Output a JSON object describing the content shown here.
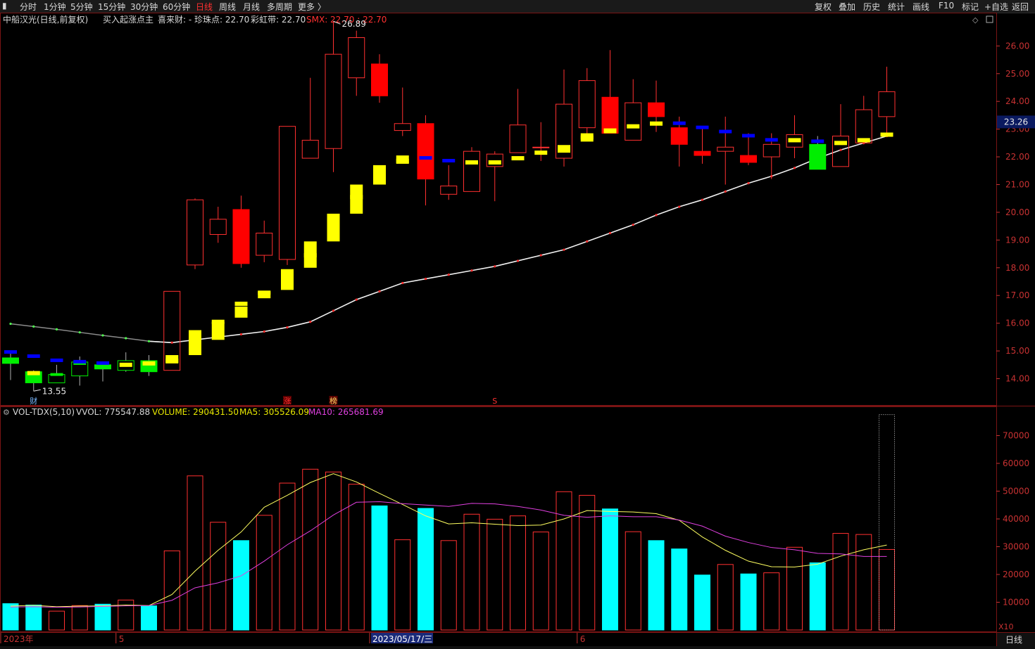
{
  "toolbar": {
    "left_icon": "menu-icon",
    "periods": [
      "分时",
      "1分钟",
      "5分钟",
      "15分钟",
      "30分钟",
      "60分钟",
      "日线",
      "周线",
      "月线",
      "多周期",
      "更多 〉"
    ],
    "active_period": "日线",
    "right": [
      "复权",
      "叠加",
      "历史",
      "统计",
      "画线",
      "F10",
      "标记",
      "+自选",
      "返回"
    ]
  },
  "price_header": {
    "title": "中船汉光(日线,前复权)",
    "indicator": "买入起涨点主",
    "field1": "喜来财: -",
    "field2": "珍珠点: 22.70",
    "field3": "彩虹带: 22.70",
    "field4": "SMX: 22.70 : 22.70"
  },
  "volume_header": {
    "name": "VOL-TDX(5,10)",
    "vvol": "VVOL: 775547.88",
    "volume": "VOLUME: 290431.50",
    "ma5": "MA5: 305526.09",
    "ma10": "MA10: 265681.69"
  },
  "current_price_label": "23.26",
  "volume_unit": "X10",
  "period_label": "日线",
  "colors": {
    "up": "#ff3030",
    "down": "#00ffff",
    "red_fill": "#ff0000",
    "green_fill": "#00ee00",
    "yellow": "#ffff00",
    "blue": "#0000ff",
    "ma5": "#ffff60",
    "ma10": "#e040e0",
    "axis_text": "#c83232"
  },
  "chart_data": [
    {
      "type": "candlestick",
      "title": "中船汉光(日线,前复权)",
      "y_ticks": [
        14.0,
        15.0,
        16.0,
        17.0,
        18.0,
        19.0,
        20.0,
        21.0,
        22.0,
        23.0,
        24.0,
        25.0,
        26.0
      ],
      "ylim": [
        13.05,
        27.2
      ],
      "annotations": [
        {
          "text": "26.89",
          "value": 26.89,
          "bar": 14
        },
        {
          "text": "13.55",
          "value": 13.55,
          "bar": 1
        }
      ],
      "signals": [
        {
          "bar": 1,
          "text": "财"
        },
        {
          "bar": 12,
          "text": "涨"
        },
        {
          "bar": 14,
          "text": "榜"
        },
        {
          "bar": 21,
          "text": "S"
        }
      ],
      "x_date_labels": [
        {
          "bar": 0,
          "text": "2023年"
        },
        {
          "bar": 5,
          "text": "5"
        },
        {
          "bar": 16,
          "text": "2023/05/17/三"
        },
        {
          "bar": 25,
          "text": "6"
        }
      ],
      "bars": [
        {
          "o": 14.75,
          "h": 14.9,
          "l": 13.95,
          "c": 14.55,
          "style": "green",
          "dot": 14.65,
          "dotc": "green",
          "blue": 14.95
        },
        {
          "o": 14.25,
          "h": 14.3,
          "l": 13.55,
          "c": 13.85,
          "style": "green",
          "dot": 14.2,
          "dotc": "yellow",
          "blue": 14.8
        },
        {
          "o": 13.85,
          "h": 14.5,
          "l": 13.85,
          "c": 14.15,
          "style": "outline_green",
          "dot": 14.15,
          "dotc": "green",
          "blue": 14.65
        },
        {
          "o": 14.1,
          "h": 14.8,
          "l": 13.75,
          "c": 14.6,
          "style": "outline_green",
          "dot": 14.55,
          "dotc": "green",
          "blue": 14.6
        },
        {
          "o": 14.5,
          "h": 14.6,
          "l": 13.9,
          "c": 14.35,
          "style": "green",
          "dot": 14.45,
          "dotc": "green",
          "blue": 14.55
        },
        {
          "o": 14.3,
          "h": 14.95,
          "l": 14.25,
          "c": 14.65,
          "style": "outline_green",
          "dot": 14.5,
          "dotc": "yellow",
          "blue": null
        },
        {
          "o": 14.65,
          "h": 14.85,
          "l": 14.1,
          "c": 14.25,
          "style": "green",
          "dot": 14.55,
          "dotc": "yellow",
          "blue": null
        },
        {
          "o": 14.3,
          "h": 17.15,
          "l": 14.3,
          "c": 17.15,
          "style": "outline_red",
          "dot": 14.65,
          "dotc": "yellow",
          "blue": null
        },
        {
          "o": 18.1,
          "h": 20.5,
          "l": 17.95,
          "c": 20.45,
          "style": "outline_red",
          "dot": 15.25,
          "dotc": "yellow",
          "blue": null
        },
        {
          "o": 19.2,
          "h": 20.2,
          "l": 18.9,
          "c": 19.75,
          "style": "outline_red",
          "dot": 16.05,
          "dotc": "yellow",
          "blue": null
        },
        {
          "o": 20.1,
          "h": 20.6,
          "l": 18.0,
          "c": 18.15,
          "style": "red",
          "dot": 16.7,
          "dotc": "yellow",
          "blue": null
        },
        {
          "o": 18.45,
          "h": 19.7,
          "l": 18.2,
          "c": 19.25,
          "style": "outline_red",
          "dot": 17.1,
          "dotc": "yellow",
          "blue": null
        },
        {
          "o": 18.3,
          "h": 23.1,
          "l": 18.1,
          "c": 23.1,
          "style": "outline_red",
          "dot": 17.5,
          "dotc": "yellow",
          "blue": null
        },
        {
          "o": 21.95,
          "h": 24.85,
          "l": 21.95,
          "c": 22.6,
          "style": "outline_red",
          "dot": 18.45,
          "dotc": "yellow",
          "blue": null
        },
        {
          "o": 22.3,
          "h": 26.89,
          "l": 21.45,
          "c": 25.7,
          "style": "outline_red",
          "dot": 19.45,
          "dotc": "yellow",
          "blue": null
        },
        {
          "o": 24.85,
          "h": 26.55,
          "l": 24.2,
          "c": 26.3,
          "style": "outline_red",
          "dot": 20.55,
          "dotc": "yellow",
          "blue": null
        },
        {
          "o": 25.35,
          "h": 25.7,
          "l": 23.95,
          "c": 24.2,
          "style": "red",
          "dot": 21.4,
          "dotc": "yellow",
          "blue": null
        },
        {
          "o": 22.95,
          "h": 24.5,
          "l": 22.75,
          "c": 23.2,
          "style": "outline_red",
          "dot": 21.85,
          "dotc": "yellow",
          "blue": null
        },
        {
          "o": 23.2,
          "h": 23.5,
          "l": 20.25,
          "c": 21.2,
          "style": "red",
          "dot": 21.95,
          "dotc": "blue",
          "blue": null
        },
        {
          "o": 20.65,
          "h": 21.7,
          "l": 20.45,
          "c": 20.95,
          "style": "outline_red",
          "dot": 21.85,
          "dotc": "blue",
          "blue": null
        },
        {
          "o": 20.75,
          "h": 22.35,
          "l": 20.75,
          "c": 22.2,
          "style": "outline_red",
          "dot": 21.8,
          "dotc": "yellow",
          "blue": null
        },
        {
          "o": 21.65,
          "h": 22.2,
          "l": 20.4,
          "c": 22.1,
          "style": "outline_red",
          "dot": 21.8,
          "dotc": "yellow",
          "blue": null
        },
        {
          "o": 22.15,
          "h": 24.45,
          "l": 22.15,
          "c": 23.15,
          "style": "outline_red",
          "dot": 21.95,
          "dotc": "yellow",
          "blue": null
        },
        {
          "o": 22.35,
          "h": 23.25,
          "l": 21.85,
          "c": 22.35,
          "style": "outline_red",
          "dot": 22.15,
          "dotc": "yellow",
          "blue": null
        },
        {
          "o": 21.95,
          "h": 25.15,
          "l": 21.65,
          "c": 23.9,
          "style": "outline_red",
          "dot": 22.35,
          "dotc": "yellow",
          "blue": null
        },
        {
          "o": 23.05,
          "h": 25.2,
          "l": 22.6,
          "c": 24.75,
          "style": "outline_red",
          "dot": 22.7,
          "dotc": "yellow",
          "blue": null
        },
        {
          "o": 24.15,
          "h": 25.85,
          "l": 22.85,
          "c": 22.85,
          "style": "red",
          "dot": 22.95,
          "dotc": "yellow",
          "blue": null
        },
        {
          "o": 22.6,
          "h": 24.8,
          "l": 22.6,
          "c": 23.95,
          "style": "outline_red",
          "dot": 23.1,
          "dotc": "yellow",
          "blue": null
        },
        {
          "o": 23.95,
          "h": 24.75,
          "l": 22.9,
          "c": 23.45,
          "style": "red",
          "dot": 23.2,
          "dotc": "yellow",
          "blue": null
        },
        {
          "o": 23.05,
          "h": 23.45,
          "l": 21.65,
          "c": 22.45,
          "style": "red",
          "dot": 23.2,
          "dotc": "blue",
          "blue": null
        },
        {
          "o": 22.05,
          "h": 23.05,
          "l": 21.75,
          "c": 22.2,
          "style": "red",
          "dot": 23.05,
          "dotc": "blue",
          "blue": null
        },
        {
          "o": 22.2,
          "h": 23.45,
          "l": 21.0,
          "c": 22.35,
          "style": "outline_red",
          "dot": 22.9,
          "dotc": "blue",
          "blue": null
        },
        {
          "o": 22.05,
          "h": 22.85,
          "l": 21.7,
          "c": 21.8,
          "style": "red",
          "dot": 22.75,
          "dotc": "blue",
          "blue": null
        },
        {
          "o": 22.0,
          "h": 22.85,
          "l": 21.2,
          "c": 22.45,
          "style": "outline_red",
          "dot": 22.6,
          "dotc": "blue",
          "blue": null
        },
        {
          "o": 22.35,
          "h": 23.5,
          "l": 21.95,
          "c": 22.8,
          "style": "outline_red",
          "dot": 22.6,
          "dotc": "yellow",
          "blue": null
        },
        {
          "o": 22.45,
          "h": 22.75,
          "l": 21.55,
          "c": 21.55,
          "style": "green",
          "dot": 22.55,
          "dotc": "blue",
          "blue": null
        },
        {
          "o": 21.65,
          "h": 23.9,
          "l": 21.65,
          "c": 22.75,
          "style": "outline_red",
          "dot": 22.5,
          "dotc": "yellow",
          "blue": null
        },
        {
          "o": 22.5,
          "h": 24.2,
          "l": 22.45,
          "c": 23.7,
          "style": "outline_red",
          "dot": 22.6,
          "dotc": "yellow",
          "blue": null
        },
        {
          "o": 23.45,
          "h": 25.25,
          "l": 22.85,
          "c": 24.35,
          "style": "outline_red",
          "dot": 22.8,
          "dotc": "yellow",
          "blue": null
        }
      ],
      "ma_line": {
        "name": "SMX",
        "points": [
          [
            0,
            15.98
          ],
          [
            1,
            15.88
          ],
          [
            2,
            15.78
          ],
          [
            3,
            15.67
          ],
          [
            4,
            15.56
          ],
          [
            5,
            15.46
          ],
          [
            6,
            15.35
          ],
          [
            7,
            15.3
          ],
          [
            8,
            15.4
          ],
          [
            9,
            15.5
          ],
          [
            10,
            15.6
          ],
          [
            11,
            15.7
          ],
          [
            12,
            15.85
          ],
          [
            13,
            16.05
          ],
          [
            14,
            16.45
          ],
          [
            15,
            16.85
          ],
          [
            16,
            17.15
          ],
          [
            17,
            17.45
          ],
          [
            18,
            17.6
          ],
          [
            19,
            17.75
          ],
          [
            20,
            17.9
          ],
          [
            21,
            18.05
          ],
          [
            22,
            18.25
          ],
          [
            23,
            18.45
          ],
          [
            24,
            18.65
          ],
          [
            25,
            18.95
          ],
          [
            26,
            19.25
          ],
          [
            27,
            19.55
          ],
          [
            28,
            19.9
          ],
          [
            29,
            20.2
          ],
          [
            30,
            20.45
          ],
          [
            31,
            20.75
          ],
          [
            32,
            21.05
          ],
          [
            33,
            21.3
          ],
          [
            34,
            21.6
          ],
          [
            35,
            21.95
          ],
          [
            36,
            22.25
          ],
          [
            37,
            22.5
          ],
          [
            38,
            22.75
          ]
        ],
        "dot_split": 7
      }
    },
    {
      "type": "bar",
      "title": "VOL-TDX(5,10)",
      "y_ticks": [
        10000,
        20000,
        30000,
        40000,
        50000,
        60000,
        70000
      ],
      "ylim": [
        0,
        80000
      ],
      "volumes": [
        9500,
        9000,
        6800,
        8800,
        9300,
        10800,
        8700,
        28500,
        55500,
        38800,
        32200,
        41300,
        52900,
        57900,
        56900,
        52500,
        44700,
        32500,
        43800,
        32200,
        41700,
        39900,
        41100,
        35300,
        49800,
        48500,
        43600,
        35400,
        32200,
        29200,
        19800,
        23600,
        20200,
        20600,
        29800,
        24200,
        34800,
        34400,
        29000
      ],
      "down_bars": [
        0,
        1,
        4,
        6,
        10,
        16,
        18,
        26,
        28,
        29,
        30,
        32,
        35
      ],
      "partial_bar": {
        "bar": 38,
        "value": 77550
      },
      "ma5": [
        8600,
        8900,
        8400,
        8600,
        8700,
        9000,
        8800,
        12800,
        21200,
        28700,
        35300,
        44200,
        48500,
        53100,
        56300,
        53300,
        49200,
        45200,
        41100,
        38200,
        38600,
        38100,
        37600,
        37800,
        40000,
        43000,
        42700,
        42500,
        41900,
        39500,
        33500,
        28700,
        24800,
        22800,
        22700,
        23700,
        26600,
        28900,
        30600
      ],
      "ma10": [
        8300,
        8400,
        8200,
        8300,
        8500,
        8700,
        8800,
        10700,
        15200,
        17000,
        19500,
        24800,
        30700,
        35700,
        41400,
        46000,
        46200,
        45500,
        45000,
        44500,
        45600,
        45400,
        44500,
        43200,
        41300,
        40600,
        41100,
        40800,
        40800,
        39600,
        37400,
        33800,
        31500,
        29700,
        28900,
        27600,
        27400,
        26500,
        26500
      ]
    }
  ]
}
